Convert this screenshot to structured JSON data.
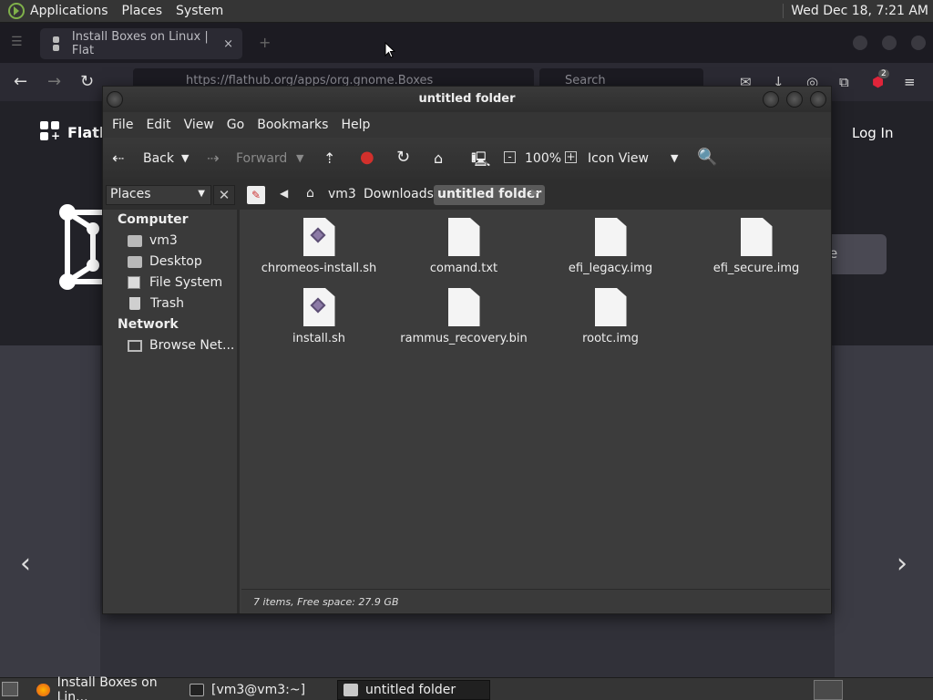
{
  "top_panel": {
    "menus": [
      "Applications",
      "Places",
      "System"
    ],
    "clock": "Wed Dec 18,  7:21 AM"
  },
  "browser": {
    "tab_title": "Install Boxes on Linux | Flat",
    "tab_close": "×",
    "url": "https://flathub.org/apps/org.gnome.Boxes",
    "search_placeholder": "Search",
    "brand": "Flath",
    "login": "Log In",
    "install_fragment": "e",
    "extension_badge": "2"
  },
  "file_manager": {
    "title": "untitled folder",
    "menu": [
      "File",
      "Edit",
      "View",
      "Go",
      "Bookmarks",
      "Help"
    ],
    "toolbar": {
      "back": "Back",
      "forward": "Forward",
      "zoom": "100%",
      "view_mode": "Icon View"
    },
    "places_label": "Places",
    "places_close": "✕",
    "breadcrumbs": [
      "vm3",
      "Downloads",
      "untitled folder"
    ],
    "sidebar": {
      "computer_header": "Computer",
      "computer_items": [
        "vm3",
        "Desktop",
        "File System",
        "Trash"
      ],
      "network_header": "Network",
      "network_items": [
        "Browse Net..."
      ]
    },
    "files": [
      {
        "name": "chromeos-install.sh",
        "type": "script"
      },
      {
        "name": "comand.txt",
        "type": "text"
      },
      {
        "name": "efi_legacy.img",
        "type": "text"
      },
      {
        "name": "efi_secure.img",
        "type": "text"
      },
      {
        "name": "install.sh",
        "type": "script"
      },
      {
        "name": "rammus_recovery.bin",
        "type": "text"
      },
      {
        "name": "rootc.img",
        "type": "text"
      }
    ],
    "status": "7 items, Free space: 27.9 GB"
  },
  "taskbar": {
    "tasks": [
      "Install Boxes on Lin...",
      "[vm3@vm3:~]",
      "untitled folder"
    ]
  },
  "colors": {
    "panel": "#353535",
    "fm_background": "#404040",
    "browser_background": "#2b2a33",
    "accent_green": "#7fb04a"
  }
}
